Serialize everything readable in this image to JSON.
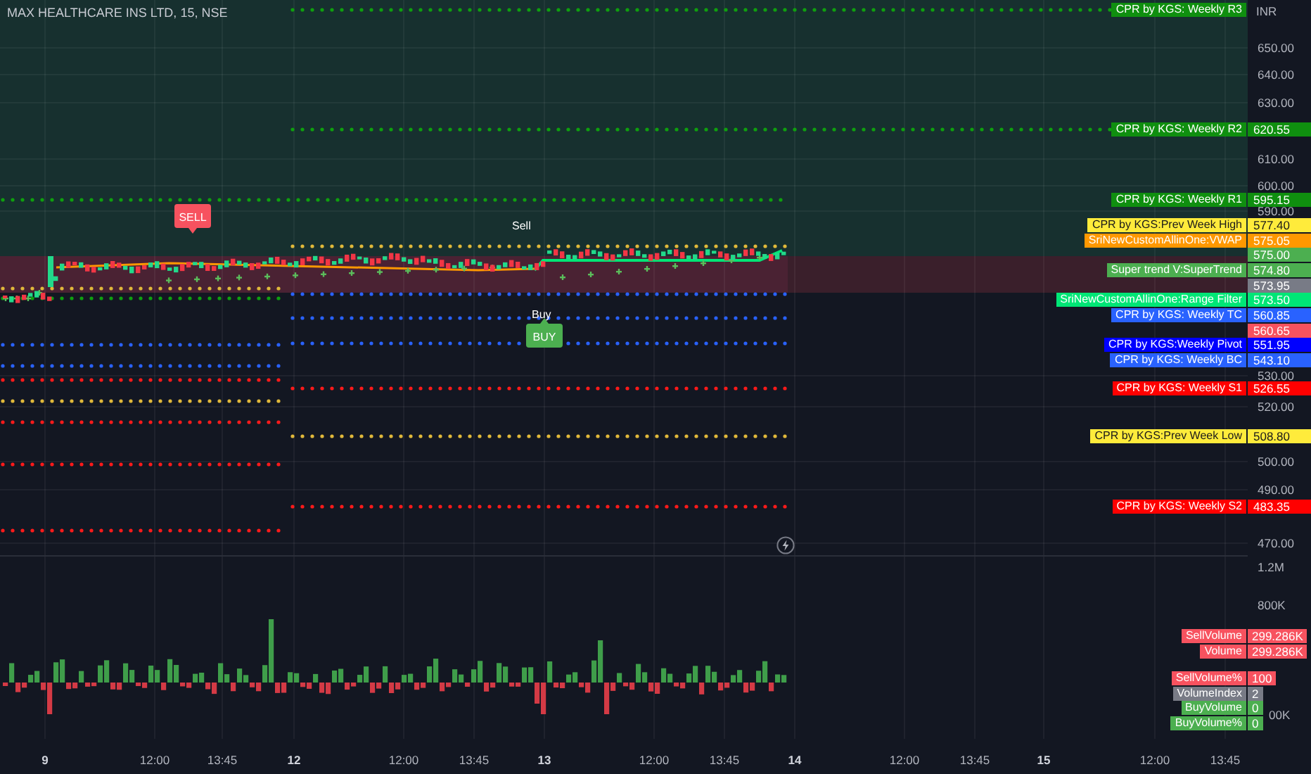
{
  "header": {
    "title": "MAX HEALTHCARE INS LTD, 15, NSE"
  },
  "price_axis": {
    "currency": "INR",
    "ticks": [
      "650.00",
      "640.00",
      "630.00",
      "610.00",
      "600.00",
      "590.00",
      "530.00",
      "520.00",
      "500.00",
      "490.00",
      "470.00"
    ]
  },
  "indicator_labels": [
    {
      "name": "CPR by KGS: Weekly R3",
      "color": "#0f8f0f"
    },
    {
      "name": "CPR by KGS: Weekly R2",
      "value": "620.55",
      "color": "#0f8f0f"
    },
    {
      "name": "CPR by KGS: Weekly R1",
      "value": "595.15",
      "color": "#0f8f0f"
    },
    {
      "name": "CPR by KGS:Prev Week High",
      "value": "577.40",
      "color": "#ffeb3b"
    },
    {
      "name": "SriNewCustomAllinOne:VWAP",
      "value": "575.05",
      "color": "#ff9800"
    },
    {
      "value": "575.00",
      "color": "#4caf50"
    },
    {
      "name": "Super trend V:SuperTrend",
      "value": "574.80",
      "color": "#4caf50"
    },
    {
      "value": "573.95",
      "color": "#787b86"
    },
    {
      "name": "SriNewCustomAllinOne:Range Filter",
      "value": "573.50",
      "color": "#00e676"
    },
    {
      "name": "CPR by KGS: Weekly TC",
      "value": "560.85",
      "color": "#2962ff"
    },
    {
      "value": "560.65",
      "color": "#f7525f"
    },
    {
      "name": "CPR by KGS:Weekly Pivot",
      "value": "551.95",
      "color": "#0000ff"
    },
    {
      "name": "CPR by KGS: Weekly BC",
      "value": "543.10",
      "color": "#2962ff"
    },
    {
      "name": "CPR by KGS: Weekly S1",
      "value": "526.55",
      "color": "#ff0000"
    },
    {
      "name": "CPR by KGS:Prev Week Low",
      "value": "508.80",
      "color": "#ffeb3b"
    },
    {
      "name": "CPR by KGS: Weekly S2",
      "value": "483.35",
      "color": "#ff0000"
    }
  ],
  "signals": [
    {
      "kind": "sell-badge",
      "text": "SELL"
    },
    {
      "kind": "sell-text",
      "text": "Sell"
    },
    {
      "kind": "buy-text",
      "text": "Buy"
    },
    {
      "kind": "buy-badge",
      "text": "BUY"
    }
  ],
  "volume_axis": {
    "ticks": [
      "1.2M",
      "800K",
      "00K"
    ]
  },
  "volume_labels": [
    {
      "name": "SellVolume",
      "value": "299.286K",
      "color": "#f7525f"
    },
    {
      "name": "Volume",
      "value": "299.286K",
      "color": "#f7525f"
    },
    {
      "name": "SellVolume%",
      "value": "100",
      "color": "#f7525f"
    },
    {
      "name": "VolumeIndex",
      "value": "2",
      "color": "#787b86"
    },
    {
      "name": "BuyVolume",
      "value": "0",
      "color": "#4caf50"
    },
    {
      "name": "BuyVolume%",
      "value": "0",
      "color": "#4caf50"
    }
  ],
  "time_axis": [
    {
      "label": "9",
      "kind": "day"
    },
    {
      "label": "12:00",
      "kind": "time"
    },
    {
      "label": "13:45",
      "kind": "time"
    },
    {
      "label": "12",
      "kind": "day"
    },
    {
      "label": "12:00",
      "kind": "time"
    },
    {
      "label": "13:45",
      "kind": "time"
    },
    {
      "label": "13",
      "kind": "day"
    },
    {
      "label": "12:00",
      "kind": "time"
    },
    {
      "label": "13:45",
      "kind": "time"
    },
    {
      "label": "14",
      "kind": "day"
    },
    {
      "label": "12:00",
      "kind": "time"
    },
    {
      "label": "13:45",
      "kind": "time"
    },
    {
      "label": "15",
      "kind": "day"
    },
    {
      "label": "12:00",
      "kind": "time"
    },
    {
      "label": "13:45",
      "kind": "time"
    }
  ]
}
